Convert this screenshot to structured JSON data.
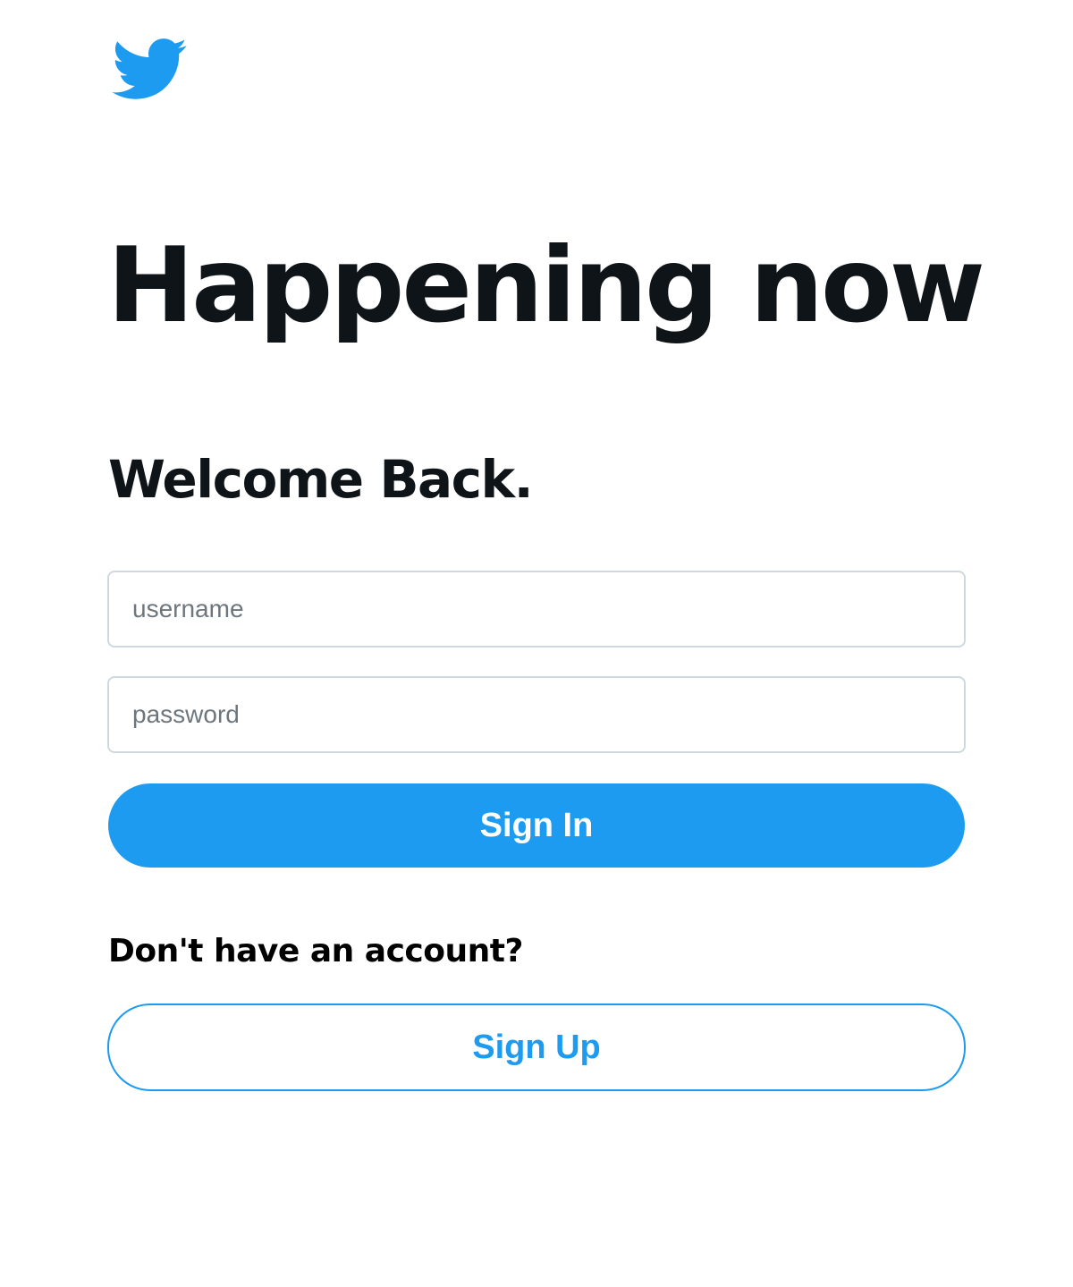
{
  "brand": {
    "logo_icon": "twitter-bird-icon",
    "accent_color": "#1d9bf0"
  },
  "hero": {
    "headline": "Happening now",
    "subheadline": "Welcome Back."
  },
  "login_form": {
    "username_placeholder": "username",
    "password_placeholder": "password",
    "sign_in_label": "Sign In"
  },
  "signup": {
    "prompt": "Don't have an account?",
    "sign_up_label": "Sign Up"
  }
}
